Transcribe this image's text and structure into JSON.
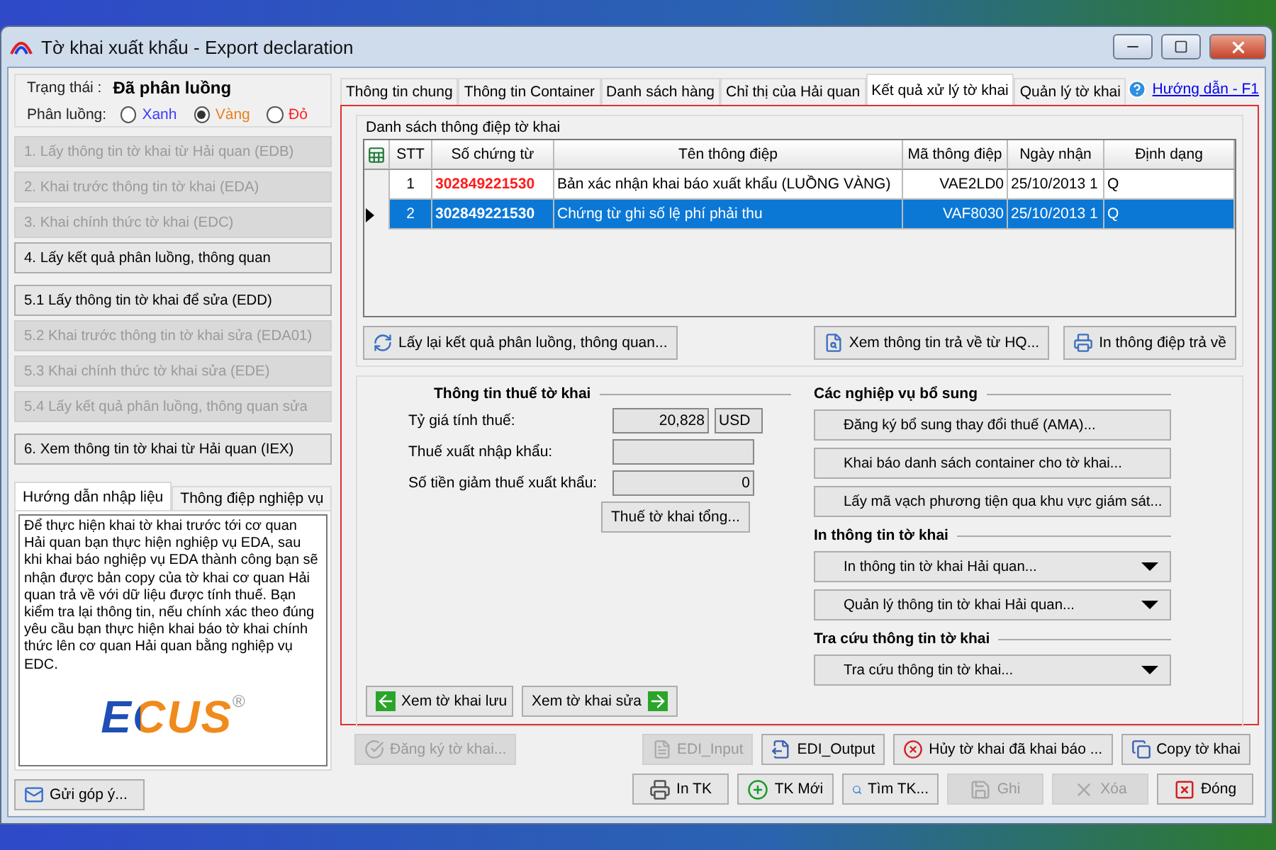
{
  "window": {
    "title": "Tờ khai xuất khẩu - Export declaration"
  },
  "status": {
    "label": "Trạng thái :",
    "value": "Đã phân luồng"
  },
  "lane": {
    "label": "Phân luồng:",
    "options": [
      {
        "label": "Xanh",
        "selected": false,
        "color": "#3b3bff"
      },
      {
        "label": "Vàng",
        "selected": true,
        "color": "#e8801f"
      },
      {
        "label": "Đỏ",
        "selected": false,
        "color": "#ff2020"
      }
    ]
  },
  "step_groups": [
    [
      {
        "label": "1. Lấy thông tin tờ khai từ Hải quan (EDB)",
        "disabled": true
      },
      {
        "label": "2. Khai trước thông tin tờ khai (EDA)",
        "disabled": true
      },
      {
        "label": "3. Khai chính thức tờ khai (EDC)",
        "disabled": true
      },
      {
        "label": "4. Lấy kết quả phân luồng, thông quan",
        "disabled": false
      }
    ],
    [
      {
        "label": "5.1 Lấy thông tin tờ khai để sửa (EDD)",
        "disabled": false
      },
      {
        "label": "5.2 Khai trước thông tin tờ khai sửa (EDA01)",
        "disabled": true
      },
      {
        "label": "5.3 Khai chính thức tờ khai sửa (EDE)",
        "disabled": true
      },
      {
        "label": "5.4 Lấy kết quả phân luồng, thông quan sửa",
        "disabled": true
      }
    ],
    [
      {
        "label": "6. Xem thông tin tờ khai từ Hải quan (IEX)",
        "disabled": false
      }
    ]
  ],
  "help_tabs": [
    {
      "label": "Hướng dẫn nhập liệu",
      "selected": true
    },
    {
      "label": "Thông điệp nghiệp vụ",
      "selected": false
    }
  ],
  "help_text": "Để thực hiện khai tờ khai trước tới cơ quan Hải quan bạn thực hiện nghiệp vụ EDA, sau khi khai báo nghiệp vụ EDA thành công bạn sẽ nhận được bản copy của tờ khai cơ quan Hải quan trả về với dữ liệu được tính thuế. Bạn kiểm tra lại thông tin, nếu chính xác theo đúng yêu cầu bạn thực hiện khai báo tờ khai chính thức lên cơ quan Hải quan bằng nghiệp vụ EDC.",
  "logo": {
    "text": "ECUS",
    "mark": "®"
  },
  "feedback_button": "Gửi góp ý...",
  "tabs": [
    {
      "label": "Thông tin chung",
      "selected": false
    },
    {
      "label": "Thông tin Container",
      "selected": false
    },
    {
      "label": "Danh sách hàng",
      "selected": false
    },
    {
      "label": "Chỉ thị của Hải quan",
      "selected": false
    },
    {
      "label": "Kết quả xử lý tờ khai",
      "selected": true
    },
    {
      "label": "Quản lý tờ khai",
      "selected": false
    }
  ],
  "help_link": "Hướng dẫn - F1",
  "messages": {
    "title": "Danh sách thông điệp tờ khai",
    "columns": [
      "STT",
      "Số chứng từ",
      "Tên thông điệp",
      "Mã thông điệp",
      "Ngày nhận",
      "Định dạng"
    ],
    "rows": [
      {
        "stt": "1",
        "doc_no": "302849221530",
        "name": "Bản xác nhận khai báo xuất khẩu (LUỒNG VÀNG)",
        "code": "VAE2LD0",
        "date": "25/10/2013 1",
        "format": "Q",
        "selected": false
      },
      {
        "stt": "2",
        "doc_no": "302849221530",
        "name": "Chứng từ ghi số lệ phí phải thu",
        "code": "VAF8030",
        "date": "25/10/2013 1",
        "format": "Q",
        "selected": true
      }
    ]
  },
  "message_buttons": [
    "Lấy lại kết quả phân luồng, thông quan...",
    "Xem thông tin trả về từ HQ...",
    "In thông điệp trả về"
  ],
  "tax": {
    "title": "Thông tin thuế tờ khai",
    "rows": [
      {
        "label": "Tỷ giá tính thuế:",
        "value": "20,828",
        "unit": "USD"
      },
      {
        "label": "Thuế xuất nhập khẩu:"
      },
      {
        "label": "Số tiền giảm thuế xuất khẩu:",
        "value": "0"
      }
    ],
    "button": "Thuế tờ khai tổng..."
  },
  "sections": [
    {
      "title": "Các nghiệp vụ bổ sung",
      "items": [
        {
          "label": "Đăng ký bổ sung thay đổi thuế (AMA)...",
          "kind": "button"
        },
        {
          "label": "Khai báo danh sách container cho tờ khai...",
          "kind": "button"
        },
        {
          "label": "Lấy mã vạch phương tiện qua khu vực giám sát...",
          "kind": "button"
        }
      ]
    },
    {
      "title": "In thông tin tờ khai",
      "items": [
        {
          "label": "In thông tin tờ khai Hải quan...",
          "kind": "dropdown"
        },
        {
          "label": "Quản lý thông tin tờ khai Hải quan...",
          "kind": "dropdown"
        }
      ]
    },
    {
      "title": "Tra cứu thông tin tờ khai",
      "items": [
        {
          "label": "Tra cứu thông tin tờ khai...",
          "kind": "dropdown"
        }
      ]
    }
  ],
  "nav_buttons": [
    "Xem tờ khai lưu",
    "Xem tờ khai sửa"
  ],
  "actions": [
    {
      "label": "Đăng ký tờ khai...",
      "disabled": true
    },
    {
      "label": "EDI_Input",
      "disabled": true
    },
    {
      "label": "EDI_Output",
      "disabled": false
    },
    {
      "label": "Hủy tờ khai đã khai báo ...",
      "disabled": false
    },
    {
      "label": "Copy tờ khai",
      "disabled": false
    }
  ],
  "toolbar": [
    {
      "label": "In TK",
      "disabled": false
    },
    {
      "label": "TK Mới",
      "disabled": false
    },
    {
      "label": "Tìm TK...",
      "disabled": false
    },
    {
      "label": "Ghi",
      "disabled": true
    },
    {
      "label": "Xóa",
      "disabled": true
    },
    {
      "label": "Đóng",
      "disabled": false
    }
  ]
}
